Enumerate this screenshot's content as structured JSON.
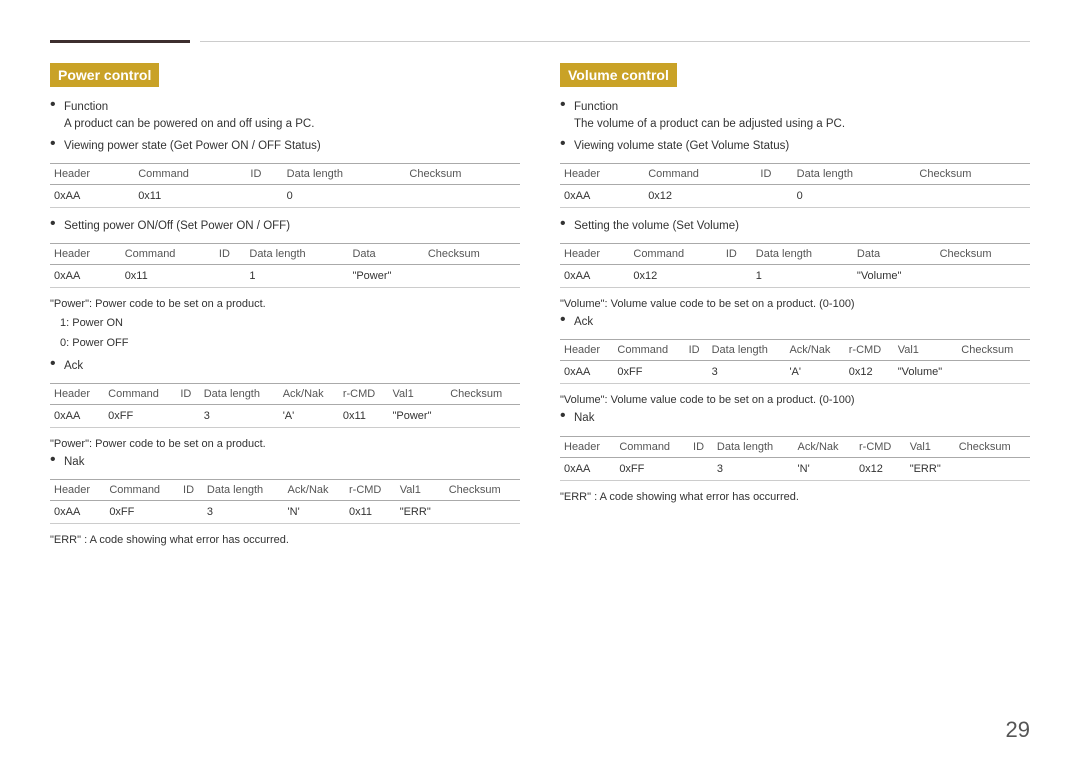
{
  "page": {
    "number": "29",
    "top_line_present": true
  },
  "power_control": {
    "title": "Power control",
    "function_label": "Function",
    "function_desc": "A product can be powered on and off using a PC.",
    "viewing_label": "Viewing power state (Get Power ON / OFF Status)",
    "table_view": {
      "headers": [
        "Header",
        "Command",
        "ID",
        "Data length",
        "Checksum"
      ],
      "rows": [
        [
          "0xAA",
          "0x11",
          "",
          "0",
          ""
        ]
      ]
    },
    "setting_label": "Setting power ON/Off (Set Power ON / OFF)",
    "table_set": {
      "headers": [
        "Header",
        "Command",
        "ID",
        "Data length",
        "Data",
        "Checksum"
      ],
      "rows": [
        [
          "0xAA",
          "0x11",
          "",
          "1",
          "\"Power\"",
          ""
        ]
      ]
    },
    "note1": "\"Power\": Power code to be set on a product.",
    "power_on": "1: Power ON",
    "power_off": "0: Power OFF",
    "ack_label": "Ack",
    "table_ack": {
      "headers": [
        "Header",
        "Command",
        "ID",
        "Data length",
        "Ack/Nak",
        "r-CMD",
        "Val1",
        "Checksum"
      ],
      "rows": [
        [
          "0xAA",
          "0xFF",
          "",
          "3",
          "'A'",
          "0x11",
          "\"Power\"",
          ""
        ]
      ]
    },
    "note2": "\"Power\": Power code to be set on a product.",
    "nak_label": "Nak",
    "table_nak": {
      "headers": [
        "Header",
        "Command",
        "ID",
        "Data length",
        "Ack/Nak",
        "r-CMD",
        "Val1",
        "Checksum"
      ],
      "rows": [
        [
          "0xAA",
          "0xFF",
          "",
          "3",
          "'N'",
          "0x11",
          "\"ERR\"",
          ""
        ]
      ]
    },
    "err_note": "\"ERR\" : A code showing what error has occurred."
  },
  "volume_control": {
    "title": "Volume control",
    "function_label": "Function",
    "function_desc": "The volume of a product can be adjusted using a PC.",
    "viewing_label": "Viewing volume state (Get Volume Status)",
    "table_view": {
      "headers": [
        "Header",
        "Command",
        "ID",
        "Data length",
        "Checksum"
      ],
      "rows": [
        [
          "0xAA",
          "0x12",
          "",
          "0",
          ""
        ]
      ]
    },
    "setting_label": "Setting the volume (Set Volume)",
    "table_set": {
      "headers": [
        "Header",
        "Command",
        "ID",
        "Data length",
        "Data",
        "Checksum"
      ],
      "rows": [
        [
          "0xAA",
          "0x12",
          "",
          "1",
          "\"Volume\"",
          ""
        ]
      ]
    },
    "note1": "\"Volume\": Volume value code to be set on a product. (0-100)",
    "ack_label": "Ack",
    "table_ack": {
      "headers": [
        "Header",
        "Command",
        "ID",
        "Data length",
        "Ack/Nak",
        "r-CMD",
        "Val1",
        "Checksum"
      ],
      "rows": [
        [
          "0xAA",
          "0xFF",
          "",
          "3",
          "'A'",
          "0x12",
          "\"Volume\"",
          ""
        ]
      ]
    },
    "note2": "\"Volume\": Volume value code to be set on a product. (0-100)",
    "nak_label": "Nak",
    "table_nak": {
      "headers": [
        "Header",
        "Command",
        "ID",
        "Data length",
        "Ack/Nak",
        "r-CMD",
        "Val1",
        "Checksum"
      ],
      "rows": [
        [
          "0xAA",
          "0xFF",
          "",
          "3",
          "'N'",
          "0x12",
          "\"ERR\"",
          ""
        ]
      ]
    },
    "err_note": "\"ERR\" : A code showing what error has occurred."
  }
}
